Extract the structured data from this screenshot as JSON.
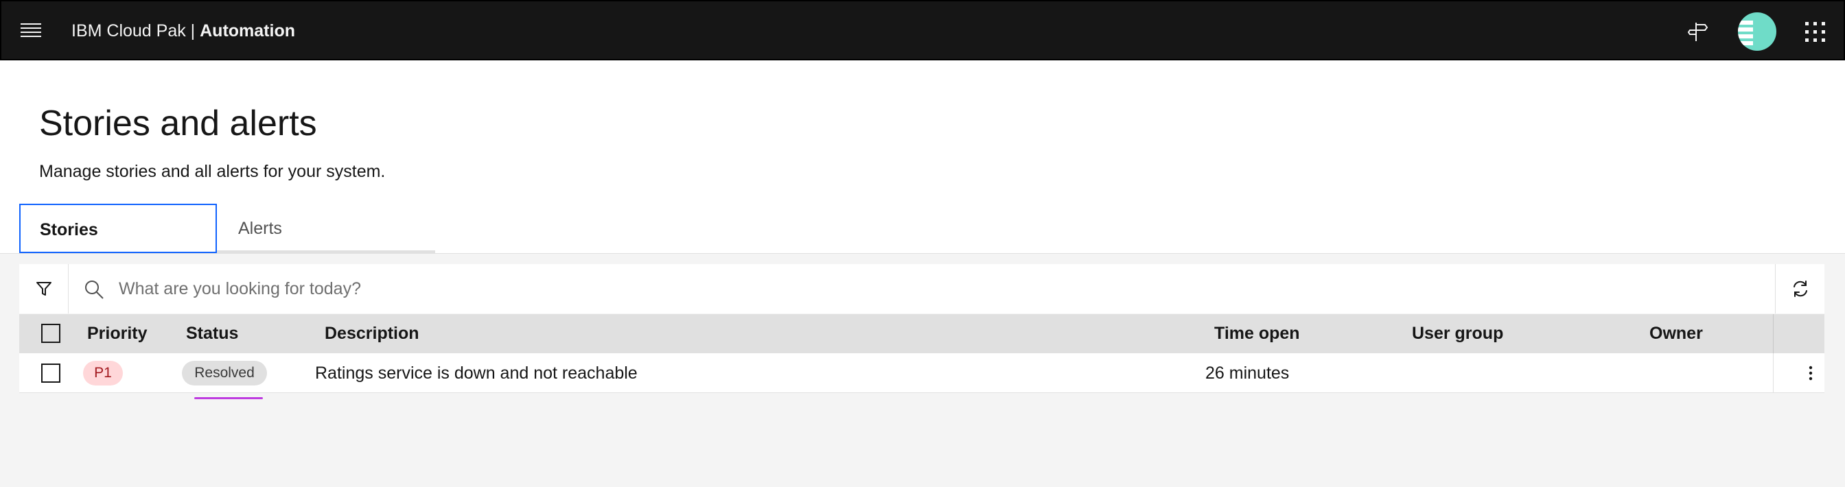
{
  "header": {
    "brand_prefix": "IBM Cloud Pak | ",
    "brand_product": "Automation",
    "icons": [
      "menu-icon",
      "guide-signpost-icon",
      "avatar",
      "app-switcher-icon"
    ]
  },
  "page": {
    "title": "Stories and alerts",
    "description": "Manage stories and all alerts for your system."
  },
  "tabs": [
    {
      "label": "Stories",
      "selected": true
    },
    {
      "label": "Alerts",
      "selected": false
    }
  ],
  "toolbar": {
    "search_placeholder": "What are you looking for today?"
  },
  "table": {
    "columns": [
      "Priority",
      "Status",
      "Description",
      "Time open",
      "User group",
      "Owner"
    ],
    "rows": [
      {
        "priority": "P1",
        "status": "Resolved",
        "description": "Ratings service is down and not reachable",
        "time_open": "26 minutes",
        "user_group": "",
        "owner": ""
      }
    ]
  },
  "colors": {
    "header_bg": "#161616",
    "accent": "#0f62fe",
    "priority_tag_bg": "#ffd7d9",
    "priority_tag_text": "#a2191f",
    "status_tag_bg": "#e0e0e0",
    "avatar": "#6fdcc8",
    "highlight_underline": "#be3ce0"
  }
}
